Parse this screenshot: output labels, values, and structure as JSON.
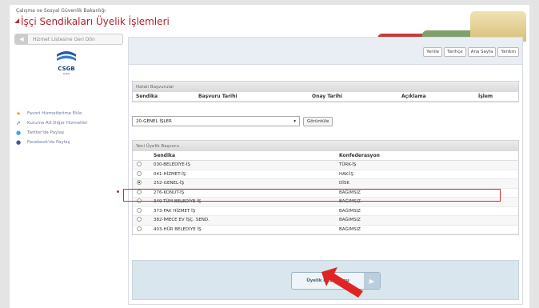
{
  "header": {
    "ministry": "Çalışma ve Sosyal Güvenlik Bakanlığı",
    "title": "İşçi Sendikaları Üyelik İşlemleri"
  },
  "sidebar": {
    "back_label": "Hizmet Listesine Geri Dön",
    "logo_text": "CSGB",
    "links": [
      {
        "label": "Favori Hizmetlerime Ekle",
        "icon": "star-icon"
      },
      {
        "label": "Kuruma Ait Diğer Hizmetler",
        "icon": "arrow-icon"
      },
      {
        "label": "Twitter'da Paylaş",
        "icon": "twitter-icon"
      },
      {
        "label": "Facebook'da Paylaş",
        "icon": "facebook-icon"
      }
    ]
  },
  "toolbar": {
    "buttons": [
      "Yenile",
      "Tarihçe",
      "Ana Sayfa",
      "Yardım"
    ]
  },
  "failed_applications": {
    "title": "Hatalı Başvurular",
    "columns": [
      "Sendika",
      "Başvuru Tarihi",
      "Onay Tarihi",
      "Açıklama",
      "İşlem"
    ]
  },
  "filter": {
    "selected": "20-GENEL İŞLER",
    "button": "Görüntüle"
  },
  "new_application": {
    "title": "Yeni Üyelik Başvuru",
    "columns": [
      "Sendika",
      "Konfederasyon"
    ],
    "rows": [
      {
        "sendika": "030-BELEDİYE-İŞ",
        "konf": "TÜRK-İŞ",
        "selected": false
      },
      {
        "sendika": "041-HİZMET-İŞ",
        "konf": "HAK-İŞ",
        "selected": false
      },
      {
        "sendika": "252-GENEL-İŞ",
        "konf": "DİSK",
        "selected": true
      },
      {
        "sendika": "276-KONUT-İŞ",
        "konf": "BAĞIMSIZ",
        "selected": false
      },
      {
        "sendika": "349-TÜM BELEDİYE-İŞ",
        "konf": "BAĞIMSIZ",
        "selected": false
      },
      {
        "sendika": "373-FAK HİZMET İŞ",
        "konf": "BAĞIMSIZ",
        "selected": false
      },
      {
        "sendika": "382-İMECE EV İŞÇ. SEND.",
        "konf": "BAĞIMSIZ",
        "selected": false
      },
      {
        "sendika": "403-HÜR BELEDİYE İŞ",
        "konf": "BAĞIMSIZ",
        "selected": false
      }
    ]
  },
  "submit": {
    "label": "Üyelik Başvurusu"
  },
  "colors": {
    "accent_red": "#d42a2a",
    "title_red": "#b0202e"
  }
}
